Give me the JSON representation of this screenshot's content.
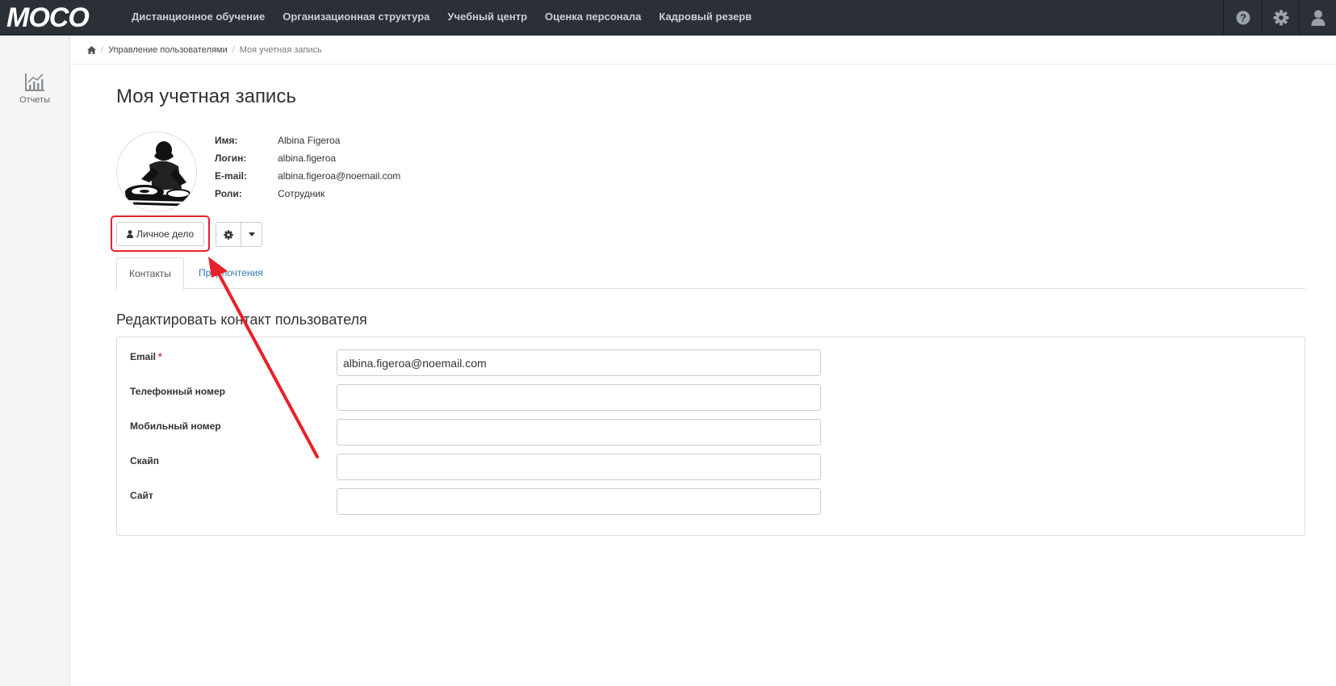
{
  "app": {
    "logo_text": "MOCO",
    "nav": [
      "Дистанционное обучение",
      "Организационная структура",
      "Учебный центр",
      "Оценка персонала",
      "Кадровый резерв"
    ],
    "top_icons": [
      "question-circle-icon",
      "gear-icon",
      "user-icon"
    ]
  },
  "sidebar": {
    "items": [
      {
        "label": "Отчеты",
        "icon": "chart-line-icon"
      }
    ]
  },
  "breadcrumb": {
    "home_icon": "home-icon",
    "items": [
      "Управление пользователями",
      "Моя учетная запись"
    ]
  },
  "page": {
    "title": "Моя учетная запись"
  },
  "profile": {
    "name_label": "Имя:",
    "name": "Albina Figeroa",
    "login_label": "Логин:",
    "login": "albina.figeroa",
    "email_label": "E-mail:",
    "email": "albina.figeroa@noemail.com",
    "roles_label": "Роли:",
    "roles": "Сотрудник"
  },
  "actions": {
    "personal_file_label": "Личное дело"
  },
  "tabs": [
    "Контакты",
    "Предпочтения"
  ],
  "contact_form": {
    "title": "Редактировать контакт пользователя",
    "fields": [
      {
        "label": "Email",
        "required": "*",
        "value": "albina.figeroa@noemail.com"
      },
      {
        "label": "Телефонный номер",
        "value": ""
      },
      {
        "label": "Мобильный номер",
        "value": ""
      },
      {
        "label": "Скайп",
        "value": ""
      },
      {
        "label": "Сайт",
        "value": ""
      }
    ]
  },
  "colors": {
    "topbar": "#2b3037",
    "link": "#337ab7",
    "annotation": "#e8202a"
  }
}
